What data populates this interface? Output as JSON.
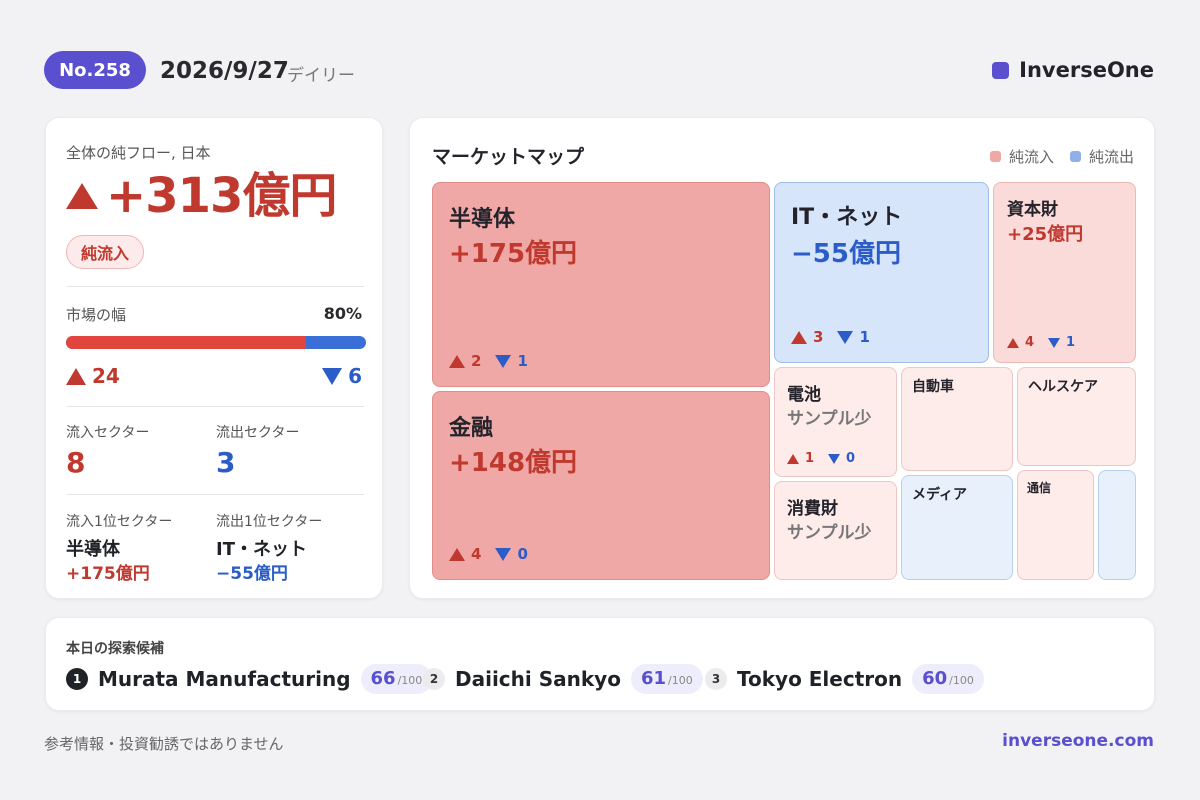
{
  "header": {
    "issue": "No.258",
    "date": "2026/9/27",
    "kind": "デイリー",
    "brand": "InverseOne",
    "brand_color": "#5a4fcf"
  },
  "summary": {
    "label": "全体の純フロー, 日本",
    "total": "+313億円",
    "direction": "純流入",
    "breadth_label": "市場の幅",
    "breadth_value": "80%",
    "breadth_fraction": 0.8,
    "up_count": "24",
    "down_count": "6",
    "inflow_sectors_label": "流入セクター",
    "inflow_sectors": "8",
    "outflow_sectors_label": "流出セクター",
    "outflow_sectors": "3",
    "top_inflow_label": "流入1位セクター",
    "top_inflow_name": "半導体",
    "top_inflow_value": "+175億円",
    "top_outflow_label": "流出1位セクター",
    "top_outflow_name": "IT・ネット",
    "top_outflow_value": "−55億円"
  },
  "market_map": {
    "title": "マーケットマップ",
    "legend_in": "純流入",
    "legend_out": "純流出",
    "legend_in_color": "#efa8a5",
    "legend_out_color": "#8fb0ea",
    "tiles": {
      "semi": {
        "name": "半導体",
        "value": "+175億円",
        "up": "2",
        "down": "1"
      },
      "finance": {
        "name": "金融",
        "value": "+148億円",
        "up": "4",
        "down": "0"
      },
      "it": {
        "name": "IT・ネット",
        "value": "−55億円",
        "up": "3",
        "down": "1"
      },
      "capital": {
        "name": "資本財",
        "value": "+25億円",
        "up": "4",
        "down": "1"
      },
      "battery": {
        "name": "電池",
        "value": "サンプル少",
        "up": "1",
        "down": "0"
      },
      "auto": {
        "name": "自動車"
      },
      "health": {
        "name": "ヘルスケア"
      },
      "consumer": {
        "name": "消費財",
        "value": "サンプル少"
      },
      "media": {
        "name": "メディア"
      },
      "telecom": {
        "name": "通信"
      }
    }
  },
  "candidates": {
    "title": "本日の探索候補",
    "items": [
      {
        "rank": "1",
        "name": "Murata Manufacturing",
        "score": "66",
        "max": "/100"
      },
      {
        "rank": "2",
        "name": "Daiichi Sankyo",
        "score": "61",
        "max": "/100"
      },
      {
        "rank": "3",
        "name": "Tokyo Electron",
        "score": "60",
        "max": "/100"
      }
    ]
  },
  "footer": {
    "disclaimer": "参考情報・投資勧誘ではありません",
    "site": "inverseone.com"
  }
}
